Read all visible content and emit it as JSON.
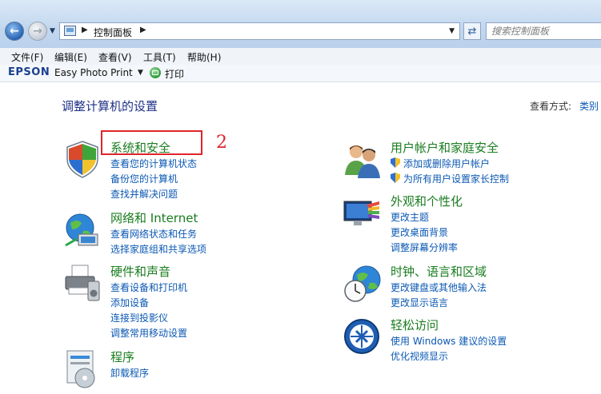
{
  "address_bar": {
    "path": "控制面板",
    "search_placeholder": "搜索控制面板"
  },
  "menu": [
    {
      "label": "文件(F)"
    },
    {
      "label": "编辑(E)"
    },
    {
      "label": "查看(V)"
    },
    {
      "label": "工具(T)"
    },
    {
      "label": "帮助(H)"
    }
  ],
  "epson_toolbar": {
    "logo": "EPSON",
    "app": "Easy Photo Print",
    "print": "打印"
  },
  "main": {
    "title": "调整计算机的设置",
    "view_by_label": "查看方式:",
    "view_by_value": "类别",
    "annotation": "2"
  },
  "categories": [
    {
      "title": "系统和安全",
      "icon": "shield-icon",
      "links": [
        "查看您的计算机状态",
        "备份您的计算机",
        "查找并解决问题"
      ]
    },
    {
      "title": "网络和 Internet",
      "icon": "network-globe-icon",
      "links": [
        "查看网络状态和任务",
        "选择家庭组和共享选项"
      ]
    },
    {
      "title": "硬件和声音",
      "icon": "printer-icon",
      "links": [
        "查看设备和打印机",
        "添加设备",
        "连接到投影仪",
        "调整常用移动设置"
      ]
    },
    {
      "title": "程序",
      "icon": "programs-icon",
      "links": [
        "卸载程序"
      ]
    },
    {
      "title": "用户帐户和家庭安全",
      "icon": "users-icon",
      "links": [
        "添加或删除用户帐户",
        "为所有用户设置家长控制"
      ]
    },
    {
      "title": "外观和个性化",
      "icon": "appearance-icon",
      "links": [
        "更改主题",
        "更改桌面背景",
        "调整屏幕分辨率"
      ]
    },
    {
      "title": "时钟、语言和区域",
      "icon": "clock-globe-icon",
      "links": [
        "更改键盘或其他输入法",
        "更改显示语言"
      ]
    },
    {
      "title": "轻松访问",
      "icon": "ease-of-access-icon",
      "links": [
        "使用 Windows 建议的设置",
        "优化视频显示"
      ]
    }
  ]
}
